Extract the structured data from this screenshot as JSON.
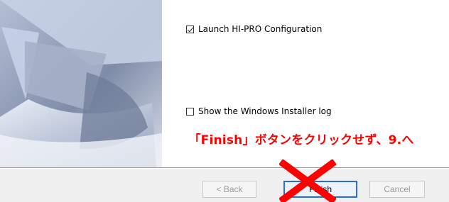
{
  "options": {
    "launch_label": "Launch HI-PRO Configuration",
    "launch_checked": true,
    "log_label": "Show the Windows Installer log",
    "log_checked": false
  },
  "annotation": {
    "text": "「Finish」ボタンをクリックせず、9.へ",
    "color": "#ff0000"
  },
  "buttons": {
    "back": "< Back",
    "finish": "Finish",
    "cancel": "Cancel"
  },
  "icons": {
    "cross": "red-x-mark"
  },
  "colors": {
    "annotation": "#ff0000",
    "cross": "#ff0000",
    "side_art_base": "#8b98b3"
  }
}
